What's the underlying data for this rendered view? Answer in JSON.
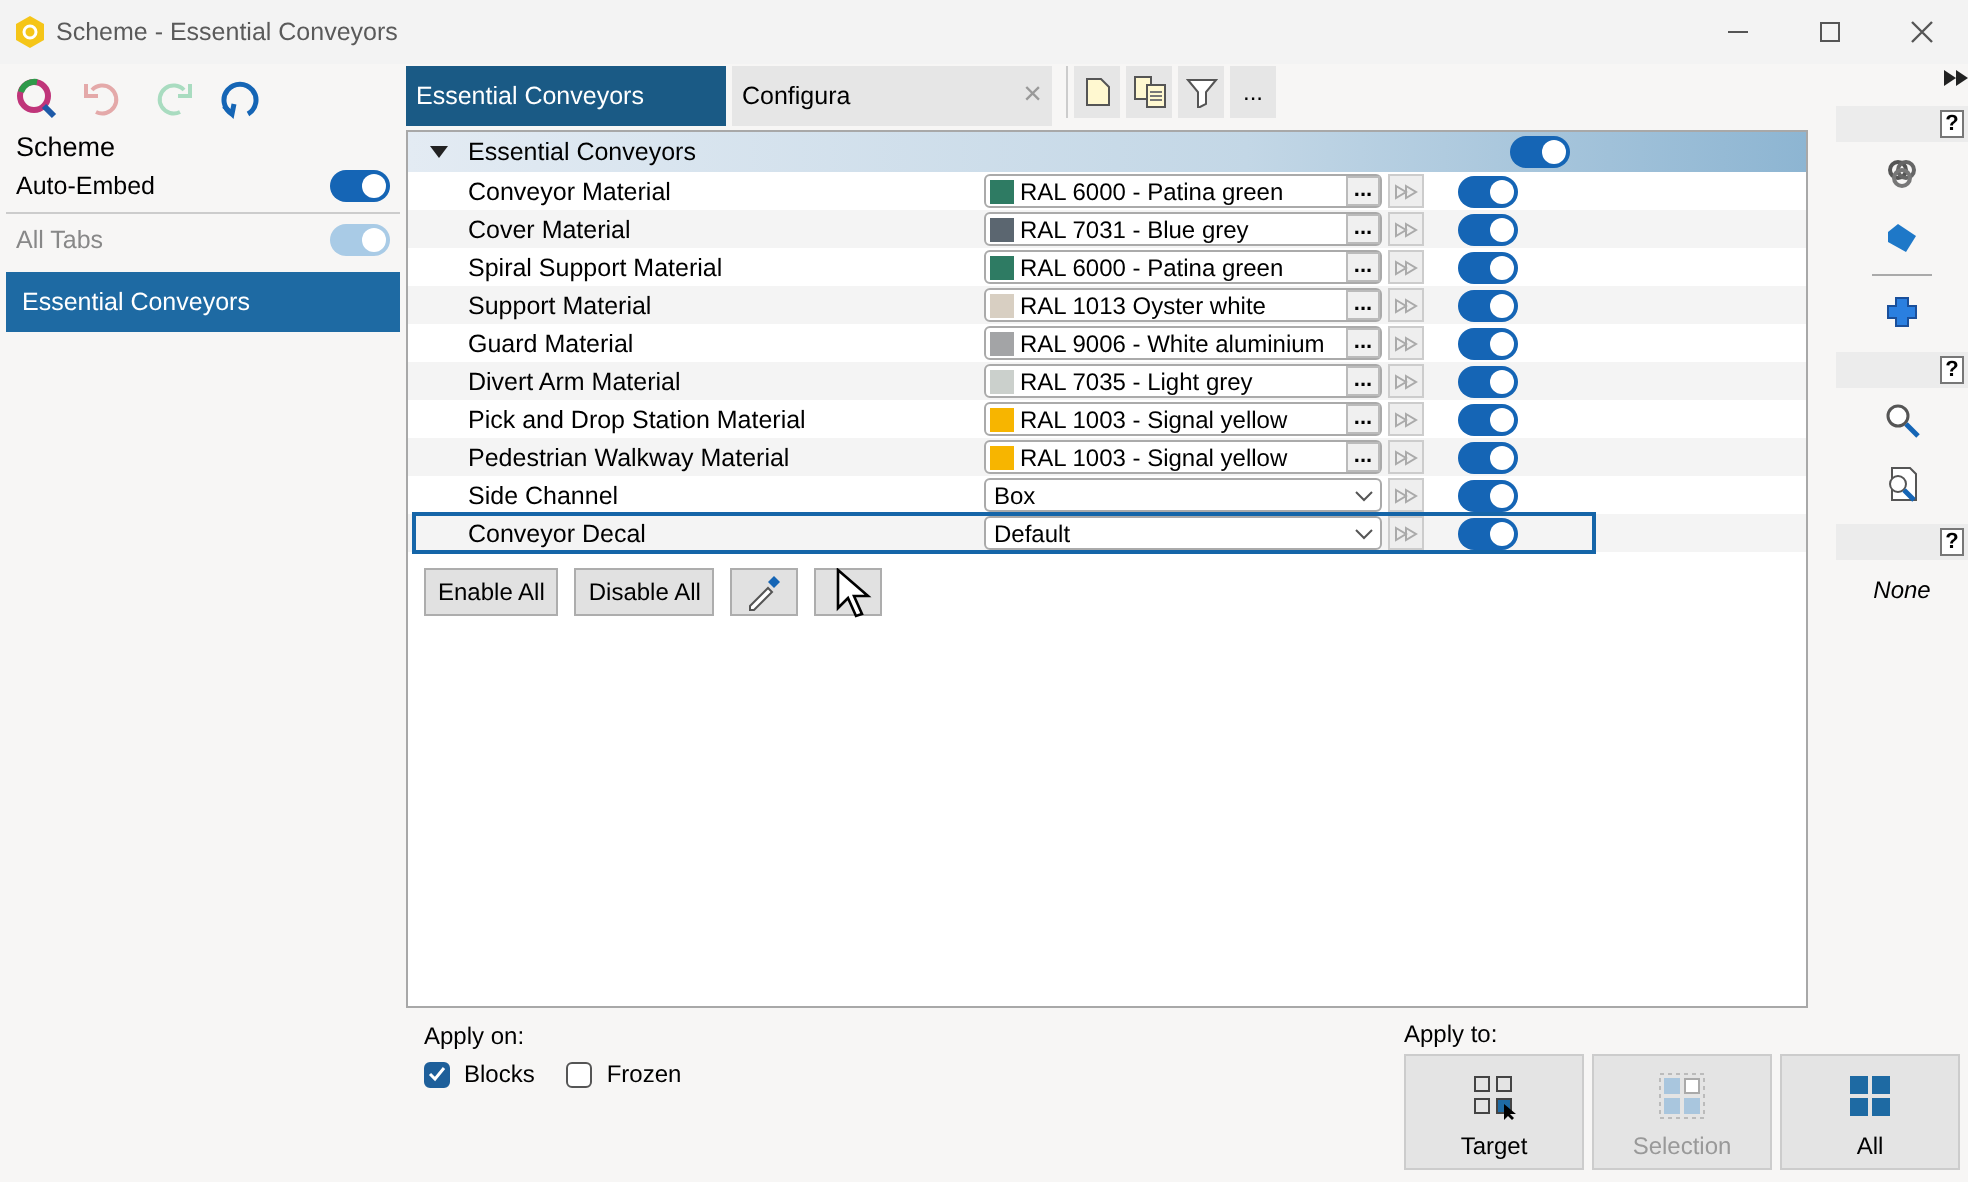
{
  "window": {
    "title": "Scheme - Essential Conveyors"
  },
  "sidebar": {
    "title": "Scheme",
    "auto_embed": {
      "label": "Auto-Embed",
      "on": true
    },
    "all_tabs": {
      "label": "All Tabs",
      "on": true,
      "disabled": true
    },
    "items": [
      {
        "label": "Essential Conveyors",
        "selected": true
      }
    ]
  },
  "tabs": [
    {
      "label": "Essential Conveyors",
      "selected": true
    },
    {
      "label": "Configura",
      "selected": false,
      "close": "×"
    }
  ],
  "toolbar": {
    "more": "..."
  },
  "group": {
    "label": "Essential Conveyors",
    "expanded": true,
    "on": true
  },
  "rows": [
    {
      "label": "Conveyor Material",
      "kind": "color",
      "value": "RAL 6000 - Patina green",
      "color": "#2e7b63",
      "browse": "...",
      "on": true,
      "selected": false
    },
    {
      "label": "Cover Material",
      "kind": "color",
      "value": "RAL 7031 - Blue grey",
      "color": "#5b6670",
      "browse": "...",
      "on": true,
      "selected": false
    },
    {
      "label": "Spiral Support Material",
      "kind": "color",
      "value": "RAL 6000 - Patina green",
      "color": "#2e7b63",
      "browse": "...",
      "on": true,
      "selected": false
    },
    {
      "label": "Support Material",
      "kind": "color",
      "value": "RAL 1013 Oyster white",
      "color": "#d8cfc2",
      "browse": "...",
      "on": true,
      "selected": false
    },
    {
      "label": "Guard Material",
      "kind": "color",
      "value": "RAL 9006 - White aluminium",
      "color": "#a3a4a6",
      "browse": "...",
      "on": true,
      "selected": false
    },
    {
      "label": "Divert Arm Material",
      "kind": "color",
      "value": "RAL 7035 - Light grey",
      "color": "#cbd0cc",
      "browse": "...",
      "on": true,
      "selected": false
    },
    {
      "label": "Pick and Drop Station Material",
      "kind": "color",
      "value": "RAL 1003 - Signal yellow",
      "color": "#f7b500",
      "browse": "...",
      "on": true,
      "selected": false
    },
    {
      "label": "Pedestrian Walkway Material",
      "kind": "color",
      "value": "RAL 1003 - Signal yellow",
      "color": "#f7b500",
      "browse": "...",
      "on": true,
      "selected": false
    },
    {
      "label": "Side Channel",
      "kind": "dropdown",
      "value": "Box",
      "on": true,
      "selected": false
    },
    {
      "label": "Conveyor Decal",
      "kind": "dropdown",
      "value": "Default",
      "on": true,
      "selected": true
    }
  ],
  "buttons": [
    "Enable All",
    "Disable All"
  ],
  "apply_on": {
    "label": "Apply on:",
    "options": [
      {
        "label": "Blocks",
        "checked": true
      },
      {
        "label": "Frozen",
        "checked": false
      }
    ]
  },
  "apply_to": {
    "label": "Apply to:",
    "options": [
      {
        "label": "Target",
        "kind": "target",
        "disabled": false
      },
      {
        "label": "Selection",
        "kind": "selection",
        "disabled": true
      },
      {
        "label": "All",
        "kind": "all",
        "disabled": false
      }
    ]
  },
  "right_panel": {
    "help": [
      "?",
      "?",
      "?"
    ],
    "status": "None"
  }
}
